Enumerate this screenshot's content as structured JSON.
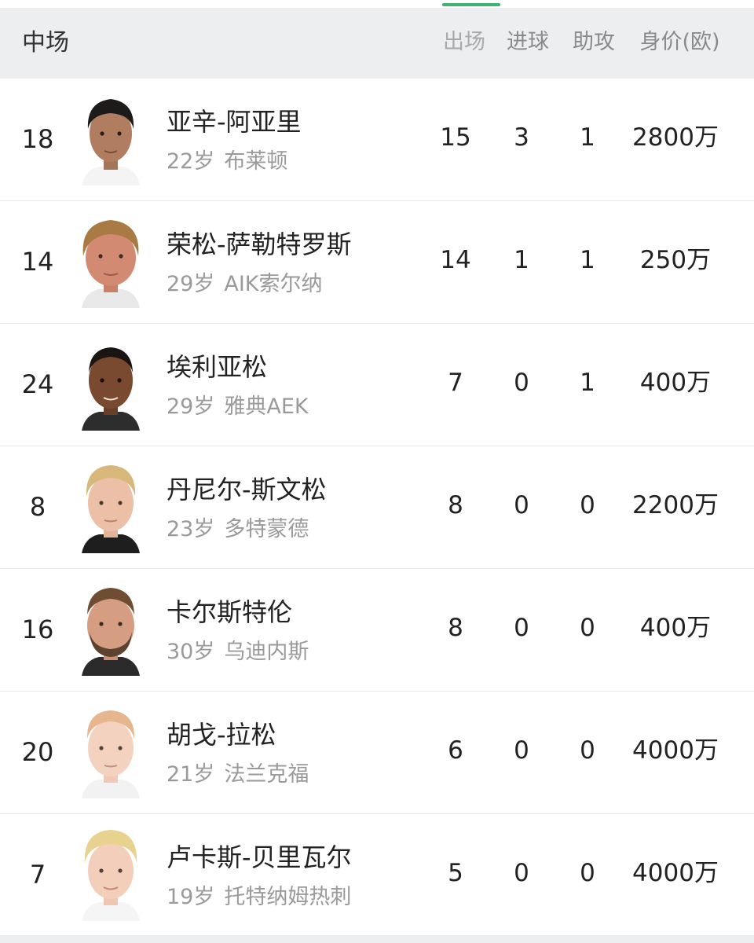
{
  "header": {
    "section_title": "中场",
    "col_apps": "出场",
    "col_goals": "进球",
    "col_assists": "助攻",
    "col_value": "身价(欧)"
  },
  "colors": {
    "accent": "#3cb371",
    "header_bg": "#eceeef",
    "primary_text": "#222222",
    "secondary_text": "#9a9a9a"
  },
  "players": [
    {
      "number": "18",
      "name": "亚辛-阿亚里",
      "age": "22岁",
      "club": "布莱顿",
      "apps": "15",
      "goals": "3",
      "assists": "1",
      "value": "2800万"
    },
    {
      "number": "14",
      "name": "荣松-萨勒特罗斯",
      "age": "29岁",
      "club": "AIK索尔纳",
      "apps": "14",
      "goals": "1",
      "assists": "1",
      "value": "250万"
    },
    {
      "number": "24",
      "name": "埃利亚松",
      "age": "29岁",
      "club": "雅典AEK",
      "apps": "7",
      "goals": "0",
      "assists": "1",
      "value": "400万"
    },
    {
      "number": "8",
      "name": "丹尼尔-斯文松",
      "age": "23岁",
      "club": "多特蒙德",
      "apps": "8",
      "goals": "0",
      "assists": "0",
      "value": "2200万"
    },
    {
      "number": "16",
      "name": "卡尔斯特伦",
      "age": "30岁",
      "club": "乌迪内斯",
      "apps": "8",
      "goals": "0",
      "assists": "0",
      "value": "400万"
    },
    {
      "number": "20",
      "name": "胡戈-拉松",
      "age": "21岁",
      "club": "法兰克福",
      "apps": "6",
      "goals": "0",
      "assists": "0",
      "value": "4000万"
    },
    {
      "number": "7",
      "name": "卢卡斯-贝里瓦尔",
      "age": "19岁",
      "club": "托特纳姆热刺",
      "apps": "5",
      "goals": "0",
      "assists": "0",
      "value": "4000万"
    }
  ]
}
